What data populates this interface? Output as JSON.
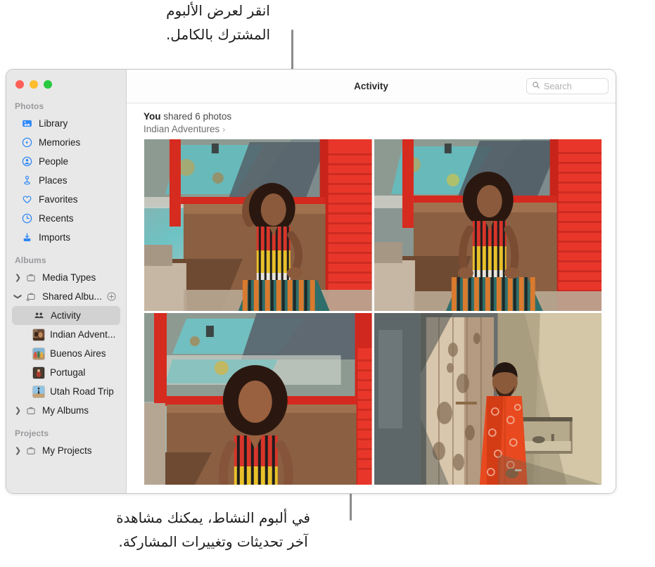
{
  "callouts": {
    "top": "انقر لعرض الألبوم\nالمشترك بالكامل.",
    "bottom": "في ألبوم النشاط، يمكنك مشاهدة\nآخر تحديثات وتغييرات المشاركة."
  },
  "window": {
    "traffic_lights": [
      {
        "name": "close",
        "color": "#ff5f57"
      },
      {
        "name": "minimize",
        "color": "#febc2e"
      },
      {
        "name": "zoom",
        "color": "#28c840"
      }
    ]
  },
  "toolbar": {
    "title": "Activity",
    "search_placeholder": "Search",
    "search_value": "",
    "search_icon": "search-icon"
  },
  "sidebar": {
    "sections": [
      {
        "title": "Photos",
        "items": [
          {
            "label": "Library",
            "icon": "photo-library-icon",
            "selected": false
          },
          {
            "label": "Memories",
            "icon": "memories-rewind-icon",
            "selected": false
          },
          {
            "label": "People",
            "icon": "person-circle-icon",
            "selected": false
          },
          {
            "label": "Places",
            "icon": "map-pin-icon",
            "selected": false
          },
          {
            "label": "Favorites",
            "icon": "heart-icon",
            "selected": false
          },
          {
            "label": "Recents",
            "icon": "clock-icon",
            "selected": false
          },
          {
            "label": "Imports",
            "icon": "import-download-icon",
            "selected": false
          }
        ]
      },
      {
        "title": "Albums",
        "items": [
          {
            "label": "Media Types",
            "icon": "folder-icon",
            "disclosure": "chevron-right-icon",
            "selected": false
          },
          {
            "label": "Shared Albu...",
            "icon": "shared-folder-icon",
            "disclosure": "chevron-down-icon",
            "selected": false,
            "action_icon": "add-circle-icon"
          },
          {
            "label": "Activity",
            "icon": "people-icon",
            "selected": true,
            "child": true
          },
          {
            "label": "Indian Advent...",
            "icon": "album-thumbnail",
            "thumb": "indian",
            "selected": false,
            "child": true
          },
          {
            "label": "Buenos Aires",
            "icon": "album-thumbnail",
            "thumb": "buenos",
            "selected": false,
            "child": true
          },
          {
            "label": "Portugal",
            "icon": "album-thumbnail",
            "thumb": "portugal",
            "selected": false,
            "child": true
          },
          {
            "label": "Utah Road Trip",
            "icon": "album-thumbnail",
            "thumb": "utah",
            "selected": false,
            "child": true
          },
          {
            "label": "My Albums",
            "icon": "folder-icon",
            "disclosure": "chevron-right-icon",
            "selected": false
          }
        ]
      },
      {
        "title": "Projects",
        "items": [
          {
            "label": "My Projects",
            "icon": "folder-icon",
            "disclosure": "chevron-right-icon",
            "selected": false
          }
        ]
      }
    ]
  },
  "activity": {
    "share_prefix": "You",
    "share_text": " shared 6 photos",
    "album_name": "Indian Adventures",
    "album_chevron": "›",
    "photos": [
      {
        "name": "woman-sitting-hand-on-head",
        "alt": "Woman in striped dress sitting on brown ledge, arm raised to head, weathered teal wall and red shutter"
      },
      {
        "name": "woman-sitting-looking-away",
        "alt": "Woman in striped dress seated, looking to the side, weathered teal wall and red shutter"
      },
      {
        "name": "woman-eyes-closed-portrait",
        "alt": "Closer portrait of woman with eyes closed against weathered teal wall"
      },
      {
        "name": "man-orange-kurta-by-door",
        "alt": "Man in orange patterned kurta standing beside a weathered wooden door"
      }
    ]
  },
  "colors": {
    "selection": "#d2d2d2",
    "sidebar_bg": "#e8e8e8",
    "accent": "#007aff",
    "section_label": "#9a9a9e"
  }
}
